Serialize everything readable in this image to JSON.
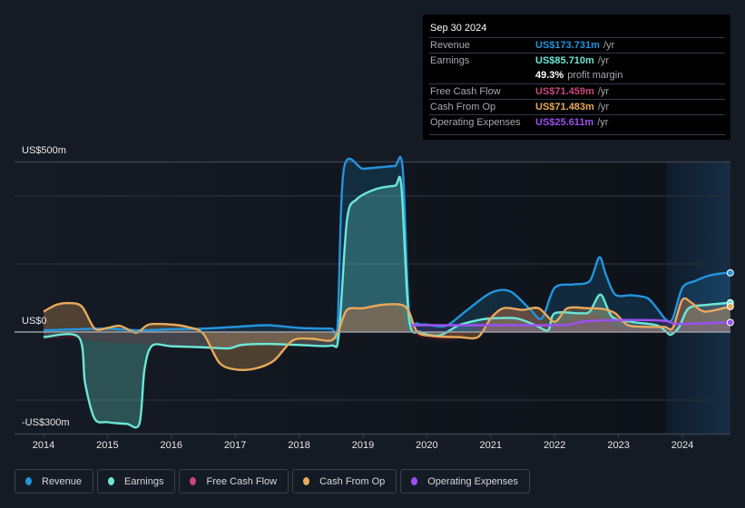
{
  "tooltip": {
    "date": "Sep 30 2024",
    "rows": [
      {
        "label": "Revenue",
        "value": "US$173.731m",
        "unit": "/yr",
        "color": "#2394df"
      },
      {
        "label": "Earnings",
        "value": "US$85.710m",
        "unit": "/yr",
        "color": "#6ce6d6"
      },
      {
        "label": "",
        "value": "49.3%",
        "unit": "profit margin",
        "color": "#ffffff"
      },
      {
        "label": "Free Cash Flow",
        "value": "US$71.459m",
        "unit": "/yr",
        "color": "#c8467b"
      },
      {
        "label": "Cash From Op",
        "value": "US$71.483m",
        "unit": "/yr",
        "color": "#e9a95b"
      },
      {
        "label": "Operating Expenses",
        "value": "US$25.611m",
        "unit": "/yr",
        "color": "#9c4ff2"
      }
    ]
  },
  "legend": [
    {
      "label": "Revenue",
      "color": "#2394df"
    },
    {
      "label": "Earnings",
      "color": "#6ce6d6"
    },
    {
      "label": "Free Cash Flow",
      "color": "#c8467b"
    },
    {
      "label": "Cash From Op",
      "color": "#e9a95b"
    },
    {
      "label": "Operating Expenses",
      "color": "#9c4ff2"
    }
  ],
  "chart_data": {
    "type": "area",
    "title": "",
    "xlabel": "",
    "ylabel": "",
    "ylim": [
      -300,
      500
    ],
    "xlim": [
      2014.0,
      2024.75
    ],
    "y_tick_labels": [
      {
        "value": 500,
        "label": "US$500m"
      },
      {
        "value": 0,
        "label": "US$0"
      },
      {
        "value": -300,
        "label": "-US$300m"
      }
    ],
    "gridlines": [
      500,
      400,
      200,
      -200
    ],
    "x_ticks": [
      2014,
      2015,
      2016,
      2017,
      2018,
      2019,
      2020,
      2021,
      2022,
      2023,
      2024
    ],
    "x_tick_labels": [
      "2014",
      "2015",
      "2016",
      "2017",
      "2018",
      "2019",
      "2020",
      "2021",
      "2022",
      "2023",
      "2024"
    ],
    "highlight_range": [
      2023.75,
      2024.75
    ],
    "units": "US$ millions (annualized)",
    "series": [
      {
        "name": "Revenue",
        "color": "#2394df",
        "x": [
          2014.0,
          2014.5,
          2015.0,
          2015.5,
          2016.0,
          2016.5,
          2017.0,
          2017.5,
          2018.0,
          2018.5,
          2018.6,
          2018.7,
          2019.0,
          2019.3,
          2019.5,
          2019.62,
          2019.72,
          2019.85,
          2020.0,
          2020.3,
          2020.6,
          2021.0,
          2021.3,
          2021.6,
          2021.8,
          2022.0,
          2022.3,
          2022.55,
          2022.7,
          2022.8,
          2022.95,
          2023.2,
          2023.45,
          2023.6,
          2023.75,
          2023.85,
          2024.0,
          2024.2,
          2024.4,
          2024.6,
          2024.75
        ],
        "values": [
          5,
          8,
          10,
          5,
          8,
          10,
          15,
          20,
          12,
          10,
          12,
          478,
          480,
          485,
          488,
          485,
          60,
          25,
          22,
          18,
          60,
          115,
          120,
          70,
          40,
          130,
          140,
          150,
          220,
          170,
          110,
          108,
          100,
          70,
          35,
          40,
          130,
          150,
          165,
          172,
          174
        ]
      },
      {
        "name": "Earnings",
        "color": "#6ce6d6",
        "x": [
          2014.0,
          2014.55,
          2014.65,
          2014.8,
          2015.0,
          2015.3,
          2015.5,
          2015.58,
          2015.7,
          2016.0,
          2016.5,
          2016.9,
          2017.1,
          2017.5,
          2018.0,
          2018.5,
          2018.62,
          2018.75,
          2018.9,
          2019.2,
          2019.5,
          2019.6,
          2019.72,
          2019.9,
          2020.2,
          2020.5,
          2020.8,
          2021.0,
          2021.4,
          2021.7,
          2021.9,
          2022.0,
          2022.4,
          2022.55,
          2022.72,
          2022.9,
          2023.2,
          2023.6,
          2023.75,
          2023.82,
          2023.95,
          2024.1,
          2024.4,
          2024.75
        ],
        "values": [
          -15,
          -15,
          -150,
          -255,
          -265,
          -270,
          -270,
          -110,
          -40,
          -42,
          -45,
          -48,
          -38,
          -35,
          -38,
          -40,
          -10,
          330,
          390,
          420,
          430,
          430,
          40,
          0,
          -10,
          20,
          35,
          40,
          40,
          20,
          5,
          55,
          55,
          60,
          110,
          45,
          30,
          20,
          0,
          -8,
          15,
          70,
          80,
          86
        ]
      },
      {
        "name": "Free Cash Flow",
        "color": "#c8467b",
        "x": [
          2014.0,
          2014.5,
          2015.0,
          2015.5,
          2016.0,
          2016.5,
          2017.0,
          2017.5,
          2018.0,
          2018.5,
          2018.7,
          2019.5,
          2019.7,
          2020.0,
          2020.5,
          2021.0,
          2021.5,
          2022.0,
          2022.5,
          2023.0,
          2023.5,
          2023.75,
          2024.0,
          2024.75
        ],
        "values": [
          -20,
          -20,
          -30,
          -35,
          -40,
          -45,
          -45,
          -38,
          -38,
          -38,
          60,
          75,
          5,
          -20,
          -20,
          55,
          60,
          20,
          60,
          15,
          12,
          10,
          90,
          71
        ]
      },
      {
        "name": "Cash From Op",
        "color": "#e9a95b",
        "x": [
          2014.0,
          2014.2,
          2014.4,
          2014.6,
          2014.8,
          2015.0,
          2015.2,
          2015.45,
          2015.65,
          2016.0,
          2016.25,
          2016.5,
          2016.75,
          2017.0,
          2017.3,
          2017.6,
          2017.9,
          2018.2,
          2018.5,
          2018.62,
          2018.75,
          2019.0,
          2019.3,
          2019.6,
          2019.72,
          2019.85,
          2020.1,
          2020.5,
          2020.8,
          2021.0,
          2021.2,
          2021.5,
          2021.75,
          2022.0,
          2022.2,
          2022.5,
          2022.75,
          2022.95,
          2023.15,
          2023.5,
          2023.72,
          2023.85,
          2024.0,
          2024.15,
          2024.35,
          2024.75
        ],
        "values": [
          60,
          80,
          85,
          75,
          10,
          12,
          18,
          -2,
          22,
          22,
          15,
          -5,
          -90,
          -110,
          -108,
          -85,
          -25,
          -20,
          -25,
          5,
          65,
          70,
          80,
          80,
          60,
          0,
          -12,
          -15,
          -15,
          40,
          70,
          65,
          70,
          30,
          70,
          70,
          68,
          55,
          20,
          15,
          15,
          12,
          95,
          85,
          60,
          75
        ]
      },
      {
        "name": "Operating Expenses",
        "color": "#9c4ff2",
        "x": [
          2019.75,
          2020.0,
          2020.5,
          2021.0,
          2021.5,
          2022.0,
          2022.2,
          2022.5,
          2023.0,
          2023.5,
          2023.75,
          2023.9,
          2024.2,
          2024.5,
          2024.75
        ],
        "values": [
          20,
          20,
          20,
          20,
          20,
          20,
          21,
          32,
          35,
          35,
          32,
          24,
          25,
          27,
          28
        ]
      }
    ]
  }
}
